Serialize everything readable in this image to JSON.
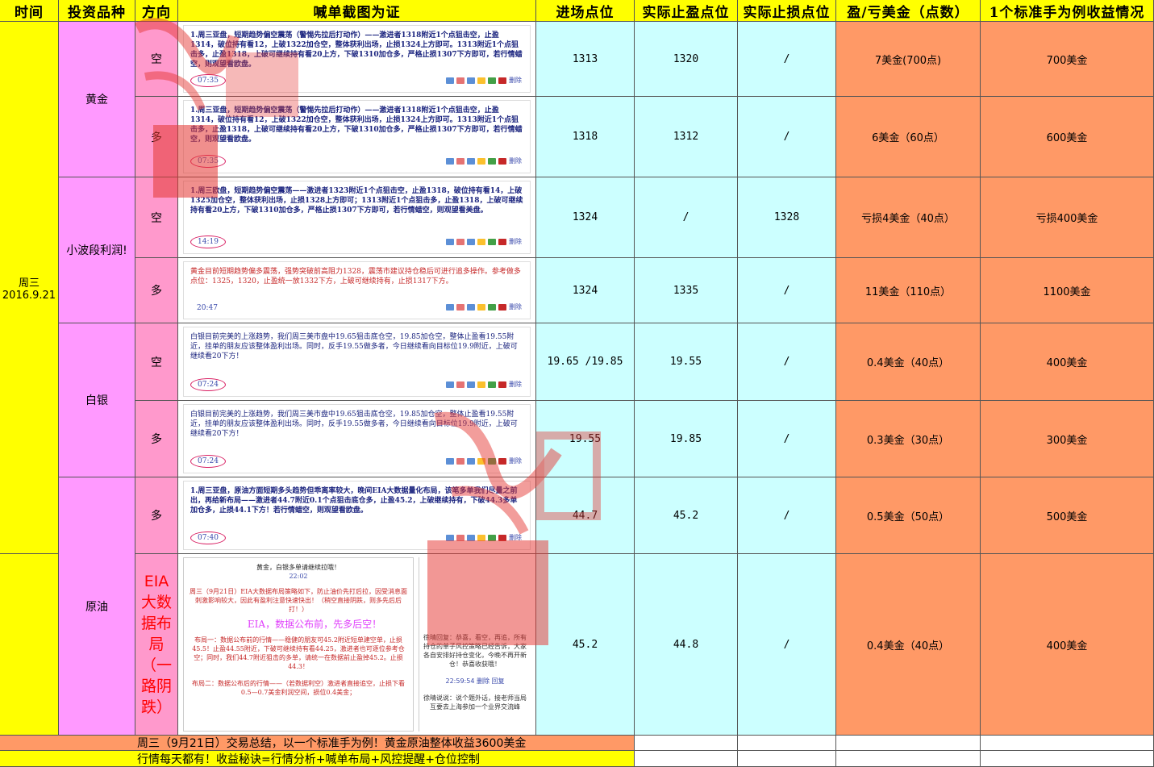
{
  "header": {
    "time": "时间",
    "product": "投资品种",
    "direction": "方向",
    "proof": "喊单截图为证",
    "entry": "进场点位",
    "take_profit": "实际止盈点位",
    "stop_loss": "实际止损点位",
    "pnl": "盈/亏美金（点数）",
    "per_lot": "1个标准手为例收益情况"
  },
  "time_cell": "周三\n2016.9.21",
  "groups": {
    "gold": "黄金",
    "small_band": "小波段利润!",
    "silver": "白银",
    "oil": "原油",
    "eia": "EIA大数据布局（一路阴跌）"
  },
  "rows": [
    {
      "dir": "空",
      "entry": "1313",
      "tp": "1320",
      "sl": "/",
      "pnl": "7美金(700点)",
      "lot": "700美金",
      "shot": "1.周三亚盘，短期趋势偏空震荡（警惕先拉后打动作）——激进者1318附近1个点狙击空，止盈1314，破位持有看12，上破1322加仓空，整体获利出场，止损1324上方即可。1313附近1个点狙击多，止盈1318，上破可继续持有看20上方，下破1310加仓多，严格止损1307下方即可，若行情蜡空，则观望看欧盘。",
      "time": "07:35"
    },
    {
      "dir": "多",
      "entry": "1318",
      "tp": "1312",
      "sl": "/",
      "pnl": "6美金（60点）",
      "lot": "600美金",
      "shot": "1.周三亚盘，短期趋势偏空震荡（警惕先拉后打动作）——激进者1318附近1个点狙击空，止盈1314，破位持有看12，上破1322加仓空，整体获利出场，止损1324上方即可。1313附近1个点狙击多，止盈1318，上破可继续持有看20上方，下破1310加仓多，严格止损1307下方即可，若行情蜡空，则观望看欧盘。",
      "time": "07:35"
    },
    {
      "dir": "空",
      "entry": "1324",
      "tp": "/",
      "sl": "1328",
      "pnl": "亏损4美金（40点）",
      "lot": "亏损400美金",
      "shot": "1.周三欧盘，短期趋势偏空震荡——激进者1323附近1个点狙击空，止盈1318，破位持有看14，上破1325加仓空，整体获利出场，止损1328上方即可；1313附近1个点狙击多，止盈1318，上破可继续持有看20上方，下破1310加仓多，严格止损1307下方即可，若行情蜡空，则观望看美盘。",
      "time": "14:19"
    },
    {
      "dir": "多",
      "entry": "1324",
      "tp": "1335",
      "sl": "/",
      "pnl": "11美金（110点）",
      "lot": "1100美金",
      "shot": "黄金目前短期趋势偏多震荡，强势突破前高阻力1328，震荡市建议持仓稳后可进行追多操作。参考做多点位：1325，1320，止盈统一放1332下方，上破可继续持有，止损1317下方。",
      "time": "20:47"
    },
    {
      "dir": "空",
      "entry": "19.65 /19.85",
      "tp": "19.55",
      "sl": "/",
      "pnl": "0.4美金（40点）",
      "lot": "400美金",
      "shot": "白银目前完美的上涨趋势，我们周三美市盘中19.65狙击底仓空，19.85加仓空，整体止盈看19.55附近，挂单的朋友应该整体盈利出场。同时，反手19.55做多者，今日继续看向目标位19.9附近，上破可继续看20下方！",
      "time": "07:24"
    },
    {
      "dir": "多",
      "entry": "19.55",
      "tp": "19.85",
      "sl": "/",
      "pnl": "0.3美金（30点）",
      "lot": "300美金",
      "shot": "白银目前完美的上涨趋势，我们周三美市盘中19.65狙击底仓空，19.85加仓空，整体止盈看19.55附近，挂单的朋友应该整体盈利出场。同时，反手19.55做多者，今日继续看向目标位19.9附近，上破可继续看20下方！",
      "time": "07:24"
    },
    {
      "dir": "多",
      "entry": "44.7",
      "tp": "45.2",
      "sl": "/",
      "pnl": "0.5美金（50点）",
      "lot": "500美金",
      "shot": "1.周三亚盘，原油方面短期多头趋势但乖离率较大，晚间EIA大数据量化布局，该笔多单我们尽量之前出，再给新布局——激进者44.7附近0.1个点狙击底仓多，止盈45.2，上破继续持有，下破44.3多单加仓多，止损44.1下方！若行情蜡空，则观望看欧盘。",
      "time": "07:40"
    },
    {
      "dir": "EIA大数据布局（一路阴跌）",
      "entry": "45.2",
      "tp": "44.8",
      "sl": "/",
      "pnl": "0.4美金（40点）",
      "lot": "400美金",
      "shot": "",
      "time": ""
    }
  ],
  "chat": {
    "line1": "黄金，白银多单请继续拉哦！",
    "time1": "22:02",
    "body": "周三（9月21日）EIA大数据布局策略如下，防止油价先打后拉，因受消息面刺激影响较大，因此有盈利注意快速快出！（稍空直接阴跌，则多先后后打！）",
    "eia_note": "EIA，数据公布前，先多后空！",
    "plan1": "布局一：数据公布前的行情——稳健的朋友可45.2附近短单建空单，止损45.5！止盈44.55附近，下破可继续持有看44.25，激进者也可逐位参考仓空；同时，我们44.7附近狙击的多单，请统一在数据前止盈掉45.2。止损44.3！",
    "plan2": "布局二：数据公布后的行情——（若数据利空）激进者直接追空，止损下看0.5—0.7美金利润空间，损位0.4美金；",
    "right1": "徐晴回复：恭喜，看空，再追，所有持仓的单子风控策略已经告诉，大家各自安排好持仓变化，今晚不再开新仓！恭喜收获哦！",
    "right_time": "22:59:54 删除 回复",
    "right2": "徐晴说说：说个题外话，接老师当局互要去上海参加一个业界交流峰"
  },
  "icons": [
    "share-icon",
    "like-icon",
    "comment-icon",
    "star-icon",
    "user-icon",
    "mail-icon",
    "delete-icon"
  ],
  "footer": {
    "summary": "周三（9月21日）交易总结，以一个标准手为例！黄金原油整体收益3600美金",
    "motto": "行情每天都有！收益秘诀=行情分析+喊单布局+风控提醒+仓位控制"
  },
  "delete_label": "删除",
  "colors": {
    "header": "#ffff00",
    "product": "#ff99ff",
    "direction": "#ff99cc",
    "points": "#ccffff",
    "profit": "#ff9966",
    "stamp": "#e53935"
  }
}
